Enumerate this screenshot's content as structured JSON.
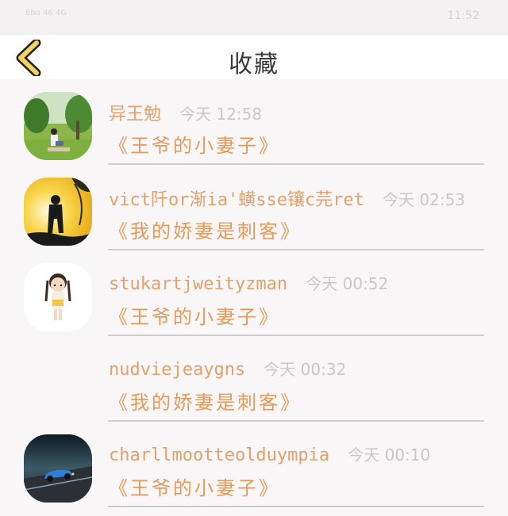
{
  "status_bar": {
    "left_text": "Ebo 46 4G",
    "right_text": "11:52"
  },
  "header": {
    "title": "收藏",
    "back_icon": "chevron-left-icon"
  },
  "favorites": [
    {
      "username": "异王勉",
      "time": "今天 12:58",
      "book": "《王爷的小妻子》",
      "avatar": "photo-person-park"
    },
    {
      "username": "vict阡or渐ia'蟥sse镶c芫ret",
      "time": "今天 02:53",
      "book": "《我的娇妻是刺客》",
      "avatar": "photo-silhouette-sunset"
    },
    {
      "username": "stukartjweityzman",
      "time": "今天 00:52",
      "book": "《王爷的小妻子》",
      "avatar": "cartoon-girl"
    },
    {
      "username": "nudviejeaygns",
      "time": "今天 00:32",
      "book": "《我的娇妻是刺客》",
      "avatar": ""
    },
    {
      "username": "charllmootteolduympia",
      "time": "今天 00:10",
      "book": "《王爷的小妻子》",
      "avatar": "photo-blue-car"
    }
  ],
  "colors": {
    "accent": "#e39a5b",
    "back_icon_fill": "#f4d35e",
    "time": "#c9c6c6",
    "divider": "#cfcccc"
  }
}
